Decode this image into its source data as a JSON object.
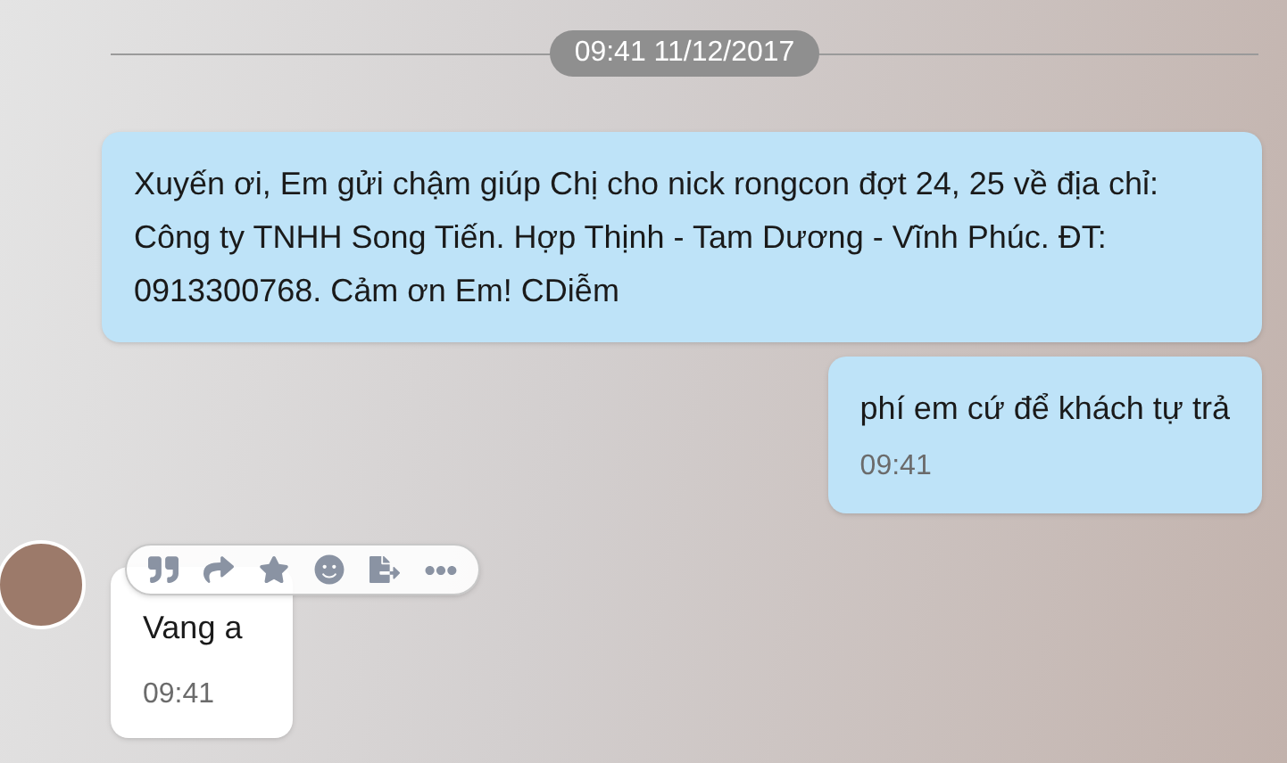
{
  "date_separator": "09:41 11/12/2017",
  "messages": [
    {
      "kind": "outgoing",
      "text": "Xuyến ơi, Em gửi chậm giúp Chị cho nick rongcon đợt 24, 25 về địa chỉ: Công ty TNHH Song Tiến. Hợp Thịnh - Tam Dương - Vĩnh Phúc. ĐT: 0913300768. Cảm ơn Em! CDiễm"
    },
    {
      "kind": "outgoing",
      "text": "phí em cứ để khách tự trả",
      "time": "09:41"
    },
    {
      "kind": "incoming",
      "text": "Vang a",
      "time": "09:41",
      "toolbar": true
    }
  ]
}
